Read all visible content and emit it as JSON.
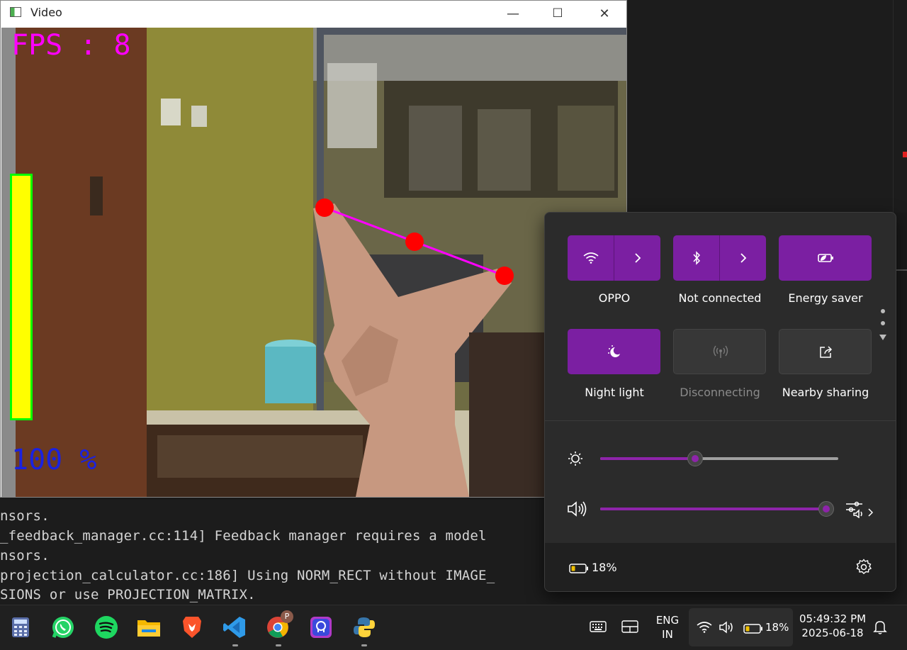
{
  "video_window": {
    "title": "Video",
    "buttons": {
      "minimize": "—",
      "maximize": "☐",
      "close": "✕"
    },
    "overlay": {
      "fps_text": "FPS : 8",
      "volume_percent_text": "100 %",
      "volume_bar_level": 1.0
    }
  },
  "terminal": {
    "lines": [
      "nsors.",
      "_feedback_manager.cc:114] Feedback manager requires a model",
      "nsors.",
      "projection_calculator.cc:186] Using NORM_RECT without IMAGE_",
      "SIONS or use PROJECTION_MATRIX."
    ]
  },
  "quick_settings": {
    "tiles": [
      {
        "label": "OPPO",
        "icon": "wifi-icon",
        "state": "on",
        "split": true
      },
      {
        "label": "Not connected",
        "icon": "bluetooth-icon",
        "state": "on",
        "split": true
      },
      {
        "label": "Energy saver",
        "icon": "energy-saver-icon",
        "state": "on",
        "split": false
      },
      {
        "label": "Night light",
        "icon": "night-light-icon",
        "state": "on",
        "split": false
      },
      {
        "label": "Disconnecting",
        "icon": "mobile-hotspot-icon",
        "state": "disabled",
        "split": false
      },
      {
        "label": "Nearby sharing",
        "icon": "share-icon",
        "state": "off",
        "split": false
      }
    ],
    "brightness_level": 0.4,
    "volume_level": 0.95,
    "battery_text": "18%",
    "accent_color": "#7b1fa2"
  },
  "taskbar": {
    "apps": [
      "calculator-icon",
      "whatsapp-icon",
      "spotify-icon",
      "file-explorer-icon",
      "brave-icon",
      "vscode-icon",
      "chrome-icon",
      "copilot-icon",
      "python-icon"
    ],
    "chrome_badge": "P",
    "language_top": "ENG",
    "language_bottom": "IN",
    "battery_text": "18%",
    "time": "05:49:32 PM",
    "date": "2025-06-18"
  }
}
